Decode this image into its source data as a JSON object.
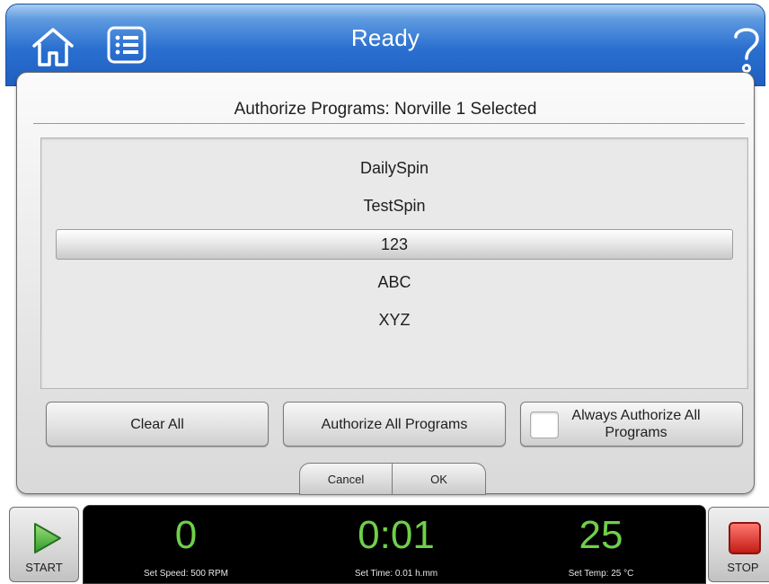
{
  "header": {
    "title": "Ready",
    "home_icon": "home-icon",
    "menu_icon": "list-icon",
    "help_icon": "help-icon",
    "colors": {
      "bar_top": "#a9ccf2",
      "bar_bottom": "#1f5fbf"
    }
  },
  "dialog": {
    "title": "Authorize Programs: Norville 1 Selected",
    "programs": [
      {
        "name": "DailySpin",
        "selected": false
      },
      {
        "name": "TestSpin",
        "selected": false
      },
      {
        "name": "123",
        "selected": true
      },
      {
        "name": "ABC",
        "selected": false
      },
      {
        "name": "XYZ",
        "selected": false
      }
    ],
    "buttons": {
      "clear_all": "Clear All",
      "authorize_all": "Authorize All Programs",
      "always_authorize": "Always Authorize All Programs",
      "always_authorize_checked": false,
      "cancel": "Cancel",
      "ok": "OK"
    }
  },
  "controls": {
    "start_label": "START",
    "stop_label": "STOP",
    "start_icon": "play-icon",
    "stop_icon": "stop-square-icon"
  },
  "status": {
    "speed_value": "0",
    "speed_label": "Set Speed: 500 RPM",
    "time_value": "0:01",
    "time_label": "Set Time: 0.01 h.mm",
    "temp_value": "25",
    "temp_label": "Set Temp: 25 °C",
    "value_color": "#6fd04a"
  }
}
